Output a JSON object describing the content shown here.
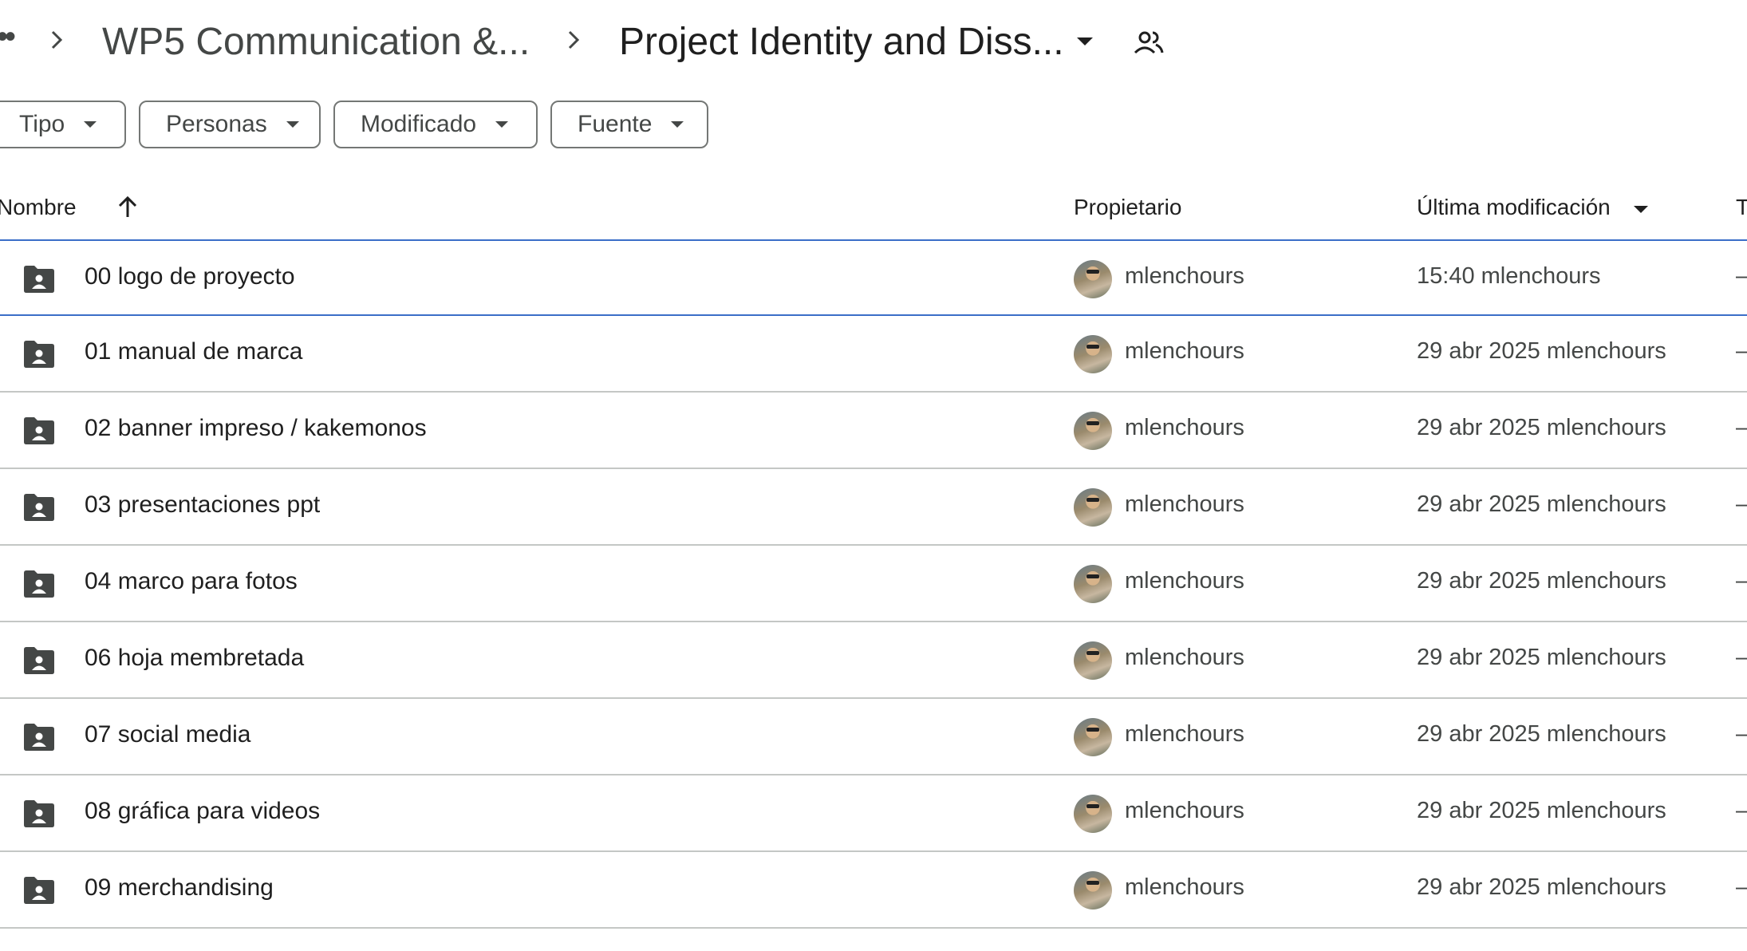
{
  "breadcrumb": {
    "overflow_label": "••",
    "parent": "WP5 Communication &...",
    "current": "Project Identity and Diss...",
    "current_dropdown_icon": "arrow-drop-down-icon",
    "shared_icon": "people-icon"
  },
  "filters": {
    "type": "Tipo",
    "people": "Personas",
    "modified": "Modificado",
    "source": "Fuente"
  },
  "table": {
    "headers": {
      "name": "Nombre",
      "owner": "Propietario",
      "modified": "Última modificación",
      "extra": "T"
    },
    "rows": [
      {
        "name": "00 logo de proyecto",
        "owner": "mlenchours",
        "modified": "15:40  mlenchours",
        "size": "—",
        "selected": true
      },
      {
        "name": "01 manual de marca",
        "owner": "mlenchours",
        "modified": "29 abr 2025  mlenchours",
        "size": "—"
      },
      {
        "name": "02 banner impreso / kakemonos",
        "owner": "mlenchours",
        "modified": "29 abr 2025  mlenchours",
        "size": "—"
      },
      {
        "name": "03 presentaciones ppt",
        "owner": "mlenchours",
        "modified": "29 abr 2025  mlenchours",
        "size": "—"
      },
      {
        "name": "04 marco para fotos",
        "owner": "mlenchours",
        "modified": "29 abr 2025  mlenchours",
        "size": "—"
      },
      {
        "name": "06 hoja membretada",
        "owner": "mlenchours",
        "modified": "29 abr 2025  mlenchours",
        "size": "—"
      },
      {
        "name": "07 social media",
        "owner": "mlenchours",
        "modified": "29 abr 2025  mlenchours",
        "size": "—"
      },
      {
        "name": "08 gráfica para videos",
        "owner": "mlenchours",
        "modified": "29 abr 2025  mlenchours",
        "size": "—"
      },
      {
        "name": "09 merchandising",
        "owner": "mlenchours",
        "modified": "29 abr 2025  mlenchours",
        "size": "—"
      }
    ]
  },
  "colors": {
    "text": "#1f1f1f",
    "secondary_text": "#444746",
    "divider": "#c4c7c5",
    "selection": "#3b6ec8",
    "chip_border": "#747775",
    "folder_icon": "#444746"
  }
}
